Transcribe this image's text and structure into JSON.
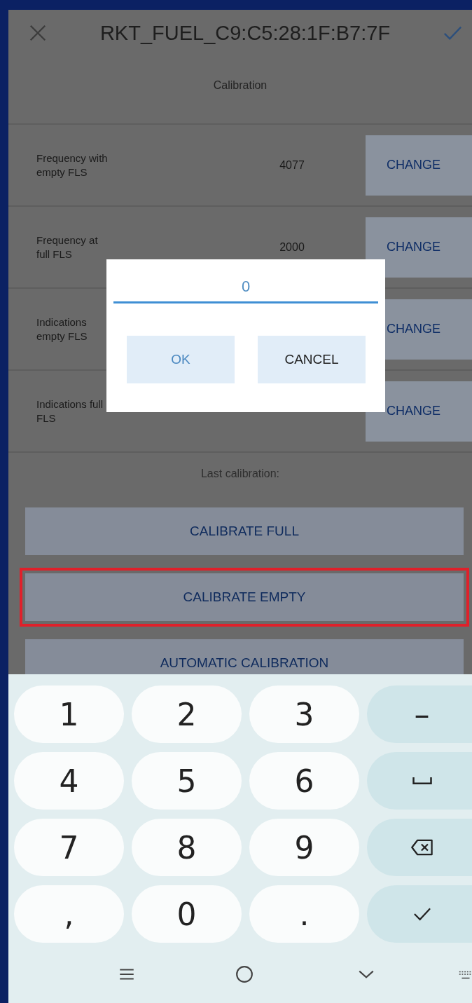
{
  "header": {
    "title": "RKT_FUEL_C9:C5:28:1F:B7:7F"
  },
  "section_title": "Calibration",
  "rows": [
    {
      "label": "Frequency with empty FLS",
      "value": "4077",
      "button": "CHANGE"
    },
    {
      "label": "Frequency at full FLS",
      "value": "2000",
      "button": "CHANGE"
    },
    {
      "label": "Indications empty FLS",
      "button": "CHANGE"
    },
    {
      "label": "Indications full FLS",
      "button": "CHANGE"
    }
  ],
  "last_calibration": "Last calibration:",
  "actions": [
    {
      "label": "CALIBRATE FULL",
      "highlighted": false
    },
    {
      "label": "CALIBRATE EMPTY",
      "highlighted": true
    },
    {
      "label": "AUTOMATIC CALIBRATION",
      "highlighted": false
    }
  ],
  "dialog": {
    "value": "0",
    "buttons": [
      {
        "label": "OK",
        "kind": "primary"
      },
      {
        "label": "CANCEL",
        "kind": "secondary"
      }
    ]
  },
  "keyboard": {
    "keys": [
      {
        "kind": "char",
        "label": "1"
      },
      {
        "kind": "char",
        "label": "2"
      },
      {
        "kind": "char",
        "label": "3"
      },
      {
        "kind": "action",
        "label": "–"
      },
      {
        "kind": "char",
        "label": "4"
      },
      {
        "kind": "char",
        "label": "5"
      },
      {
        "kind": "char",
        "label": "6"
      },
      {
        "kind": "space"
      },
      {
        "kind": "char",
        "label": "7"
      },
      {
        "kind": "char",
        "label": "8"
      },
      {
        "kind": "char",
        "label": "9"
      },
      {
        "kind": "backspace"
      },
      {
        "kind": "char",
        "label": ","
      },
      {
        "kind": "char",
        "label": "0"
      },
      {
        "kind": "char",
        "label": "."
      },
      {
        "kind": "enter"
      }
    ]
  }
}
